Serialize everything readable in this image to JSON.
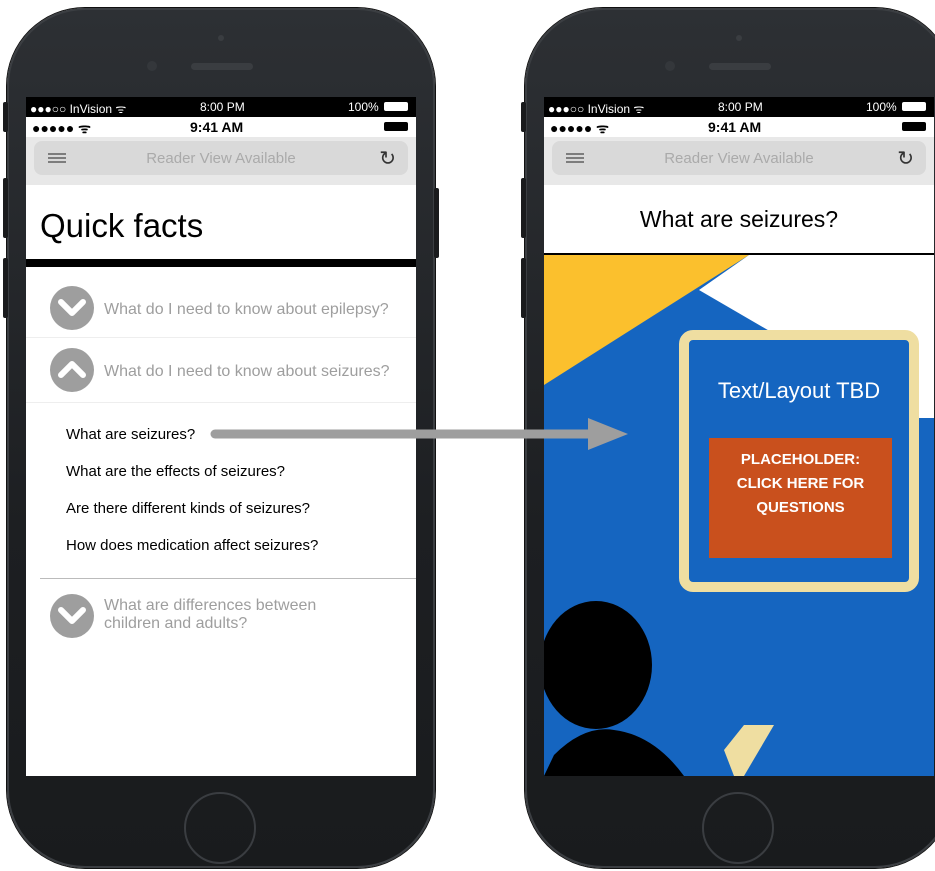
{
  "left_phone": {
    "status_bar_outer": {
      "carrier": "●●●○○ InVision ᯤ",
      "time": "8:00 PM",
      "battery": "100%"
    },
    "status_bar_inner": {
      "signal": "●●●●● ᯤ",
      "time": "9:41 AM"
    },
    "url_bar": {
      "text": "Reader View Available",
      "reload_icon": "reload-icon",
      "menu_icon": "menu-icon"
    },
    "page_title": "Quick facts",
    "accordion": [
      {
        "label": "What do I need to know about epilepsy?",
        "state": "collapsed"
      },
      {
        "label": "What do I need to know about seizures?",
        "state": "expanded",
        "sub_items": [
          "What are seizures?",
          "What are the effects of seizures?",
          "Are there different kinds of seizures?",
          "How does medication affect seizures?"
        ]
      },
      {
        "label": "What are differences between children and adults?",
        "state": "collapsed"
      }
    ]
  },
  "right_phone": {
    "status_bar_outer": {
      "carrier": "●●●○○ InVision ᯤ",
      "time": "8:00 PM",
      "battery": "100%"
    },
    "status_bar_inner": {
      "signal": "●●●●● ᯤ",
      "time": "9:41 AM"
    },
    "url_bar": {
      "text": "Reader View Available",
      "reload_icon": "reload-icon",
      "menu_icon": "menu-icon"
    },
    "page_title": "What are seizures?",
    "bubble_text": "Text/Layout TBD",
    "placeholder_button": "PLACEHOLDER:\nCLICK HERE FOR\nQUESTIONS"
  },
  "colors": {
    "blue": "#1565c0",
    "yellow": "#fbc02d",
    "cream": "#efdea1",
    "orange": "#c9501d",
    "icon_grey": "#9e9e9e",
    "arrow_grey": "#9e9e9e"
  }
}
